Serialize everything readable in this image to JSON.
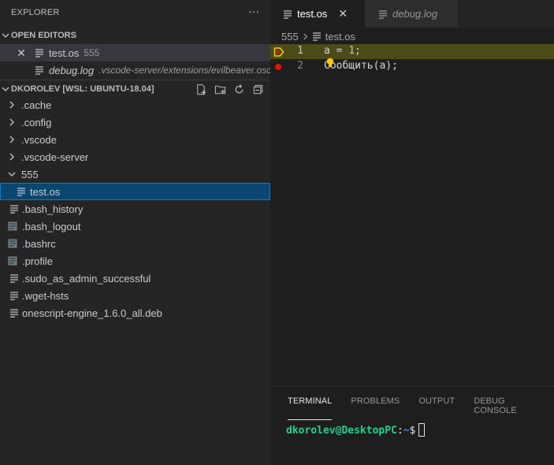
{
  "sidebar": {
    "title": "EXPLORER",
    "open_editors": {
      "header": "OPEN EDITORS",
      "items": [
        {
          "name": "test.os",
          "desc": "555"
        },
        {
          "name": "debug.log",
          "desc": ".vscode-server/extensions/evilbeaver.oscri..."
        }
      ]
    },
    "workspace": {
      "header": "DKOROLEV [WSL: UBUNTU-18.04]",
      "items": [
        {
          "label": ".cache",
          "type": "folder-collapsed"
        },
        {
          "label": ".config",
          "type": "folder-collapsed"
        },
        {
          "label": ".vscode",
          "type": "folder-collapsed"
        },
        {
          "label": ".vscode-server",
          "type": "folder-collapsed"
        },
        {
          "label": "555",
          "type": "folder-expanded"
        },
        {
          "label": "test.os",
          "type": "file-selected"
        },
        {
          "label": ".bash_history",
          "type": "file"
        },
        {
          "label": ".bash_logout",
          "type": "doc"
        },
        {
          "label": ".bashrc",
          "type": "doc"
        },
        {
          "label": ".profile",
          "type": "doc"
        },
        {
          "label": ".sudo_as_admin_successful",
          "type": "file"
        },
        {
          "label": ".wget-hsts",
          "type": "file"
        },
        {
          "label": "onescript-engine_1.6.0_all.deb",
          "type": "file"
        }
      ]
    }
  },
  "editor": {
    "tabs": [
      {
        "label": "test.os",
        "active": true
      },
      {
        "label": "debug.log",
        "active": false
      }
    ],
    "breadcrumb": {
      "folder": "555",
      "file": "test.os"
    },
    "lines": [
      {
        "number": "1",
        "text_a": "a = ",
        "num": "1",
        "text_b": ";"
      },
      {
        "number": "2",
        "text": "Сообщить(а);"
      }
    ]
  },
  "panel": {
    "tabs": [
      "TERMINAL",
      "PROBLEMS",
      "OUTPUT",
      "DEBUG CONSOLE"
    ],
    "terminal": {
      "user": "dkorolev@DesktopPC",
      "colon": ":",
      "path": "~",
      "prompt": "$"
    }
  },
  "colors": {
    "accent": "#007fd4",
    "selection": "#094771",
    "debug_current_line": "#4b4b18",
    "breakpoint": "#e51400",
    "terminal_user": "#23d18b"
  }
}
